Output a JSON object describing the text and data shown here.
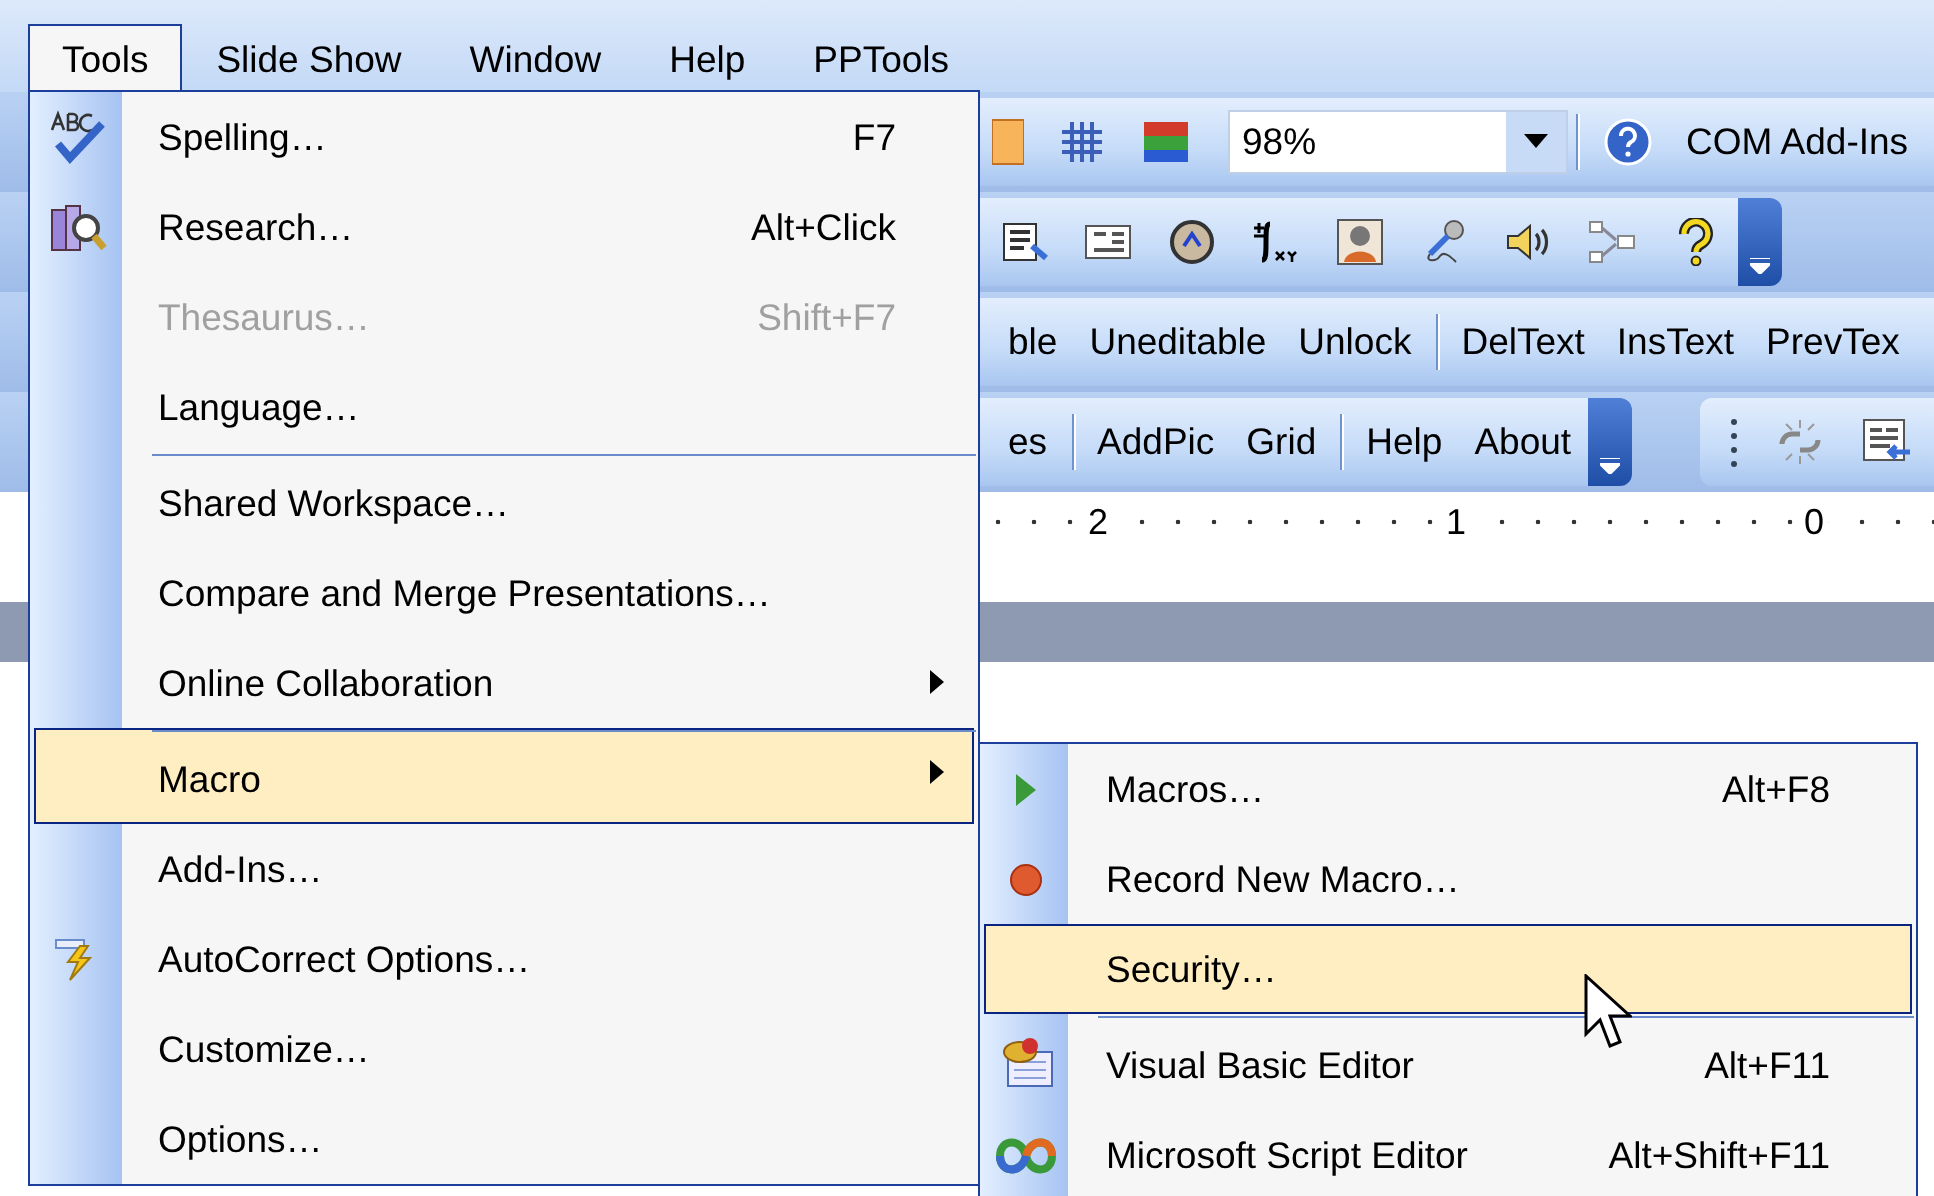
{
  "menubar": [
    {
      "label": "Tools",
      "selected": true
    },
    {
      "label": "Slide Show",
      "selected": false
    },
    {
      "label": "Window",
      "selected": false
    },
    {
      "label": "Help",
      "selected": false
    },
    {
      "label": "PPTools",
      "selected": false
    }
  ],
  "toolbar_1": {
    "zoom": "98%",
    "addins_label": "COM Add-Ins"
  },
  "toolbar_3": {
    "groups": [
      [
        "ble",
        "Uneditable",
        "Unlock"
      ],
      [
        "DelText",
        "InsText",
        "PrevTex"
      ]
    ]
  },
  "toolbar_4": {
    "groups": [
      [
        "es"
      ],
      [
        "AddPic",
        "Grid"
      ],
      [
        "Help",
        "About"
      ]
    ]
  },
  "ruler": {
    "labels": [
      "2",
      "1",
      "0"
    ]
  },
  "tools_menu": {
    "items": [
      {
        "label": "Spelling…",
        "shortcut": "F7",
        "disabled": false,
        "selected": false,
        "submenu": false,
        "separator_before": false
      },
      {
        "label": "Research…",
        "shortcut": "Alt+Click",
        "disabled": false,
        "selected": false,
        "submenu": false,
        "separator_before": false
      },
      {
        "label": "Thesaurus…",
        "shortcut": "Shift+F7",
        "disabled": true,
        "selected": false,
        "submenu": false,
        "separator_before": false
      },
      {
        "label": "Language…",
        "disabled": false,
        "selected": false,
        "submenu": false,
        "separator_before": false
      },
      {
        "label": "Shared Workspace…",
        "disabled": false,
        "selected": false,
        "submenu": false,
        "separator_before": true
      },
      {
        "label": "Compare and Merge Presentations…",
        "disabled": false,
        "selected": false,
        "submenu": false,
        "separator_before": false
      },
      {
        "label": "Online Collaboration",
        "disabled": false,
        "selected": false,
        "submenu": true,
        "separator_before": false
      },
      {
        "label": "Macro",
        "disabled": false,
        "selected": true,
        "submenu": true,
        "separator_before": true
      },
      {
        "label": "Add-Ins…",
        "disabled": false,
        "selected": false,
        "submenu": false,
        "separator_before": false
      },
      {
        "label": "AutoCorrect Options…",
        "disabled": false,
        "selected": false,
        "submenu": false,
        "separator_before": false
      },
      {
        "label": "Customize…",
        "disabled": false,
        "selected": false,
        "submenu": false,
        "separator_before": false
      },
      {
        "label": "Options…",
        "disabled": false,
        "selected": false,
        "submenu": false,
        "separator_before": false
      }
    ]
  },
  "macro_submenu": {
    "items": [
      {
        "label": "Macros…",
        "shortcut": "Alt+F8",
        "selected": false,
        "separator_before": false
      },
      {
        "label": "Record New Macro…",
        "selected": false,
        "separator_before": false
      },
      {
        "label": "Security…",
        "selected": true,
        "separator_before": false
      },
      {
        "label": "Visual Basic Editor",
        "shortcut": "Alt+F11",
        "selected": false,
        "separator_before": true
      },
      {
        "label": "Microsoft Script Editor",
        "shortcut": "Alt+Shift+F11",
        "selected": false,
        "separator_before": false
      }
    ]
  }
}
